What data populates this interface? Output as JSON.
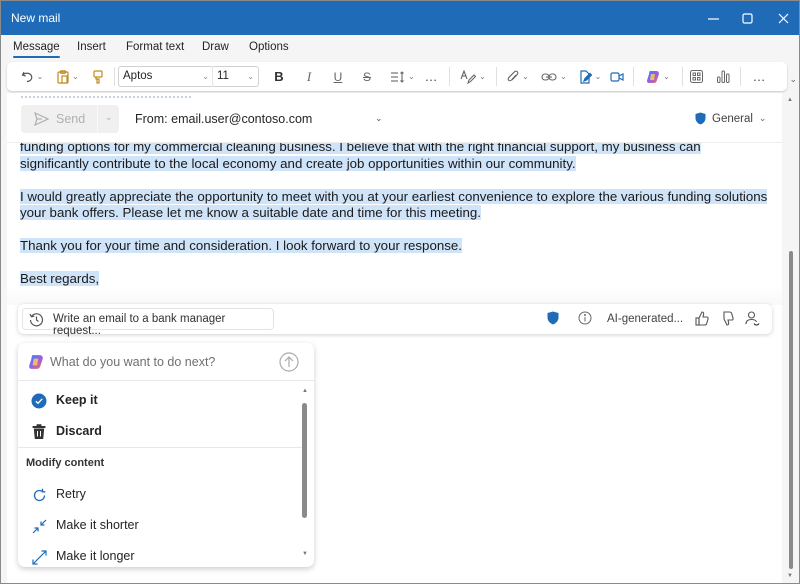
{
  "window": {
    "title": "New mail",
    "controls": {
      "minimize": "minimize-icon",
      "maximize": "maximize-icon",
      "close": "close-icon"
    }
  },
  "ribbon": {
    "tabs": [
      {
        "label": "Message",
        "active": true
      },
      {
        "label": "Insert",
        "active": false
      },
      {
        "label": "Format text",
        "active": false
      },
      {
        "label": "Draw",
        "active": false
      },
      {
        "label": "Options",
        "active": false
      }
    ],
    "font_name": "Aptos",
    "font_size": "11",
    "more_label": "…"
  },
  "header": {
    "send_label": "Send",
    "from_label": "From:",
    "from_value": "email.user@contoso.com",
    "sensitivity_label": "General"
  },
  "body": {
    "paragraphs": [
      "funding options for my commercial cleaning business. I believe that with the right financial support, my business can significantly contribute to the local economy and create job opportunities within our community.",
      "I would greatly appreciate the opportunity to meet with you at your earliest convenience to explore the various funding solutions your bank offers. Please let me know a suitable date and time for this meeting.",
      "Thank you for your time and consideration. I look forward to your response.",
      "Best regards,"
    ]
  },
  "ai_bar": {
    "prompt_text": "Write an email to a bank manager request...",
    "ai_label": "AI-generated...",
    "accent": "#1f6bb8"
  },
  "copilot_menu": {
    "input_placeholder": "What do you want to do next?",
    "items": [
      {
        "label": "Keep it",
        "icon": "check-circle-icon"
      },
      {
        "label": "Discard",
        "icon": "trash-icon"
      }
    ],
    "section_label": "Modify content",
    "modify_items": [
      {
        "label": "Retry",
        "icon": "retry-icon"
      },
      {
        "label": "Make it shorter",
        "icon": "shrink-icon"
      },
      {
        "label": "Make it longer",
        "icon": "expand-icon"
      }
    ]
  }
}
